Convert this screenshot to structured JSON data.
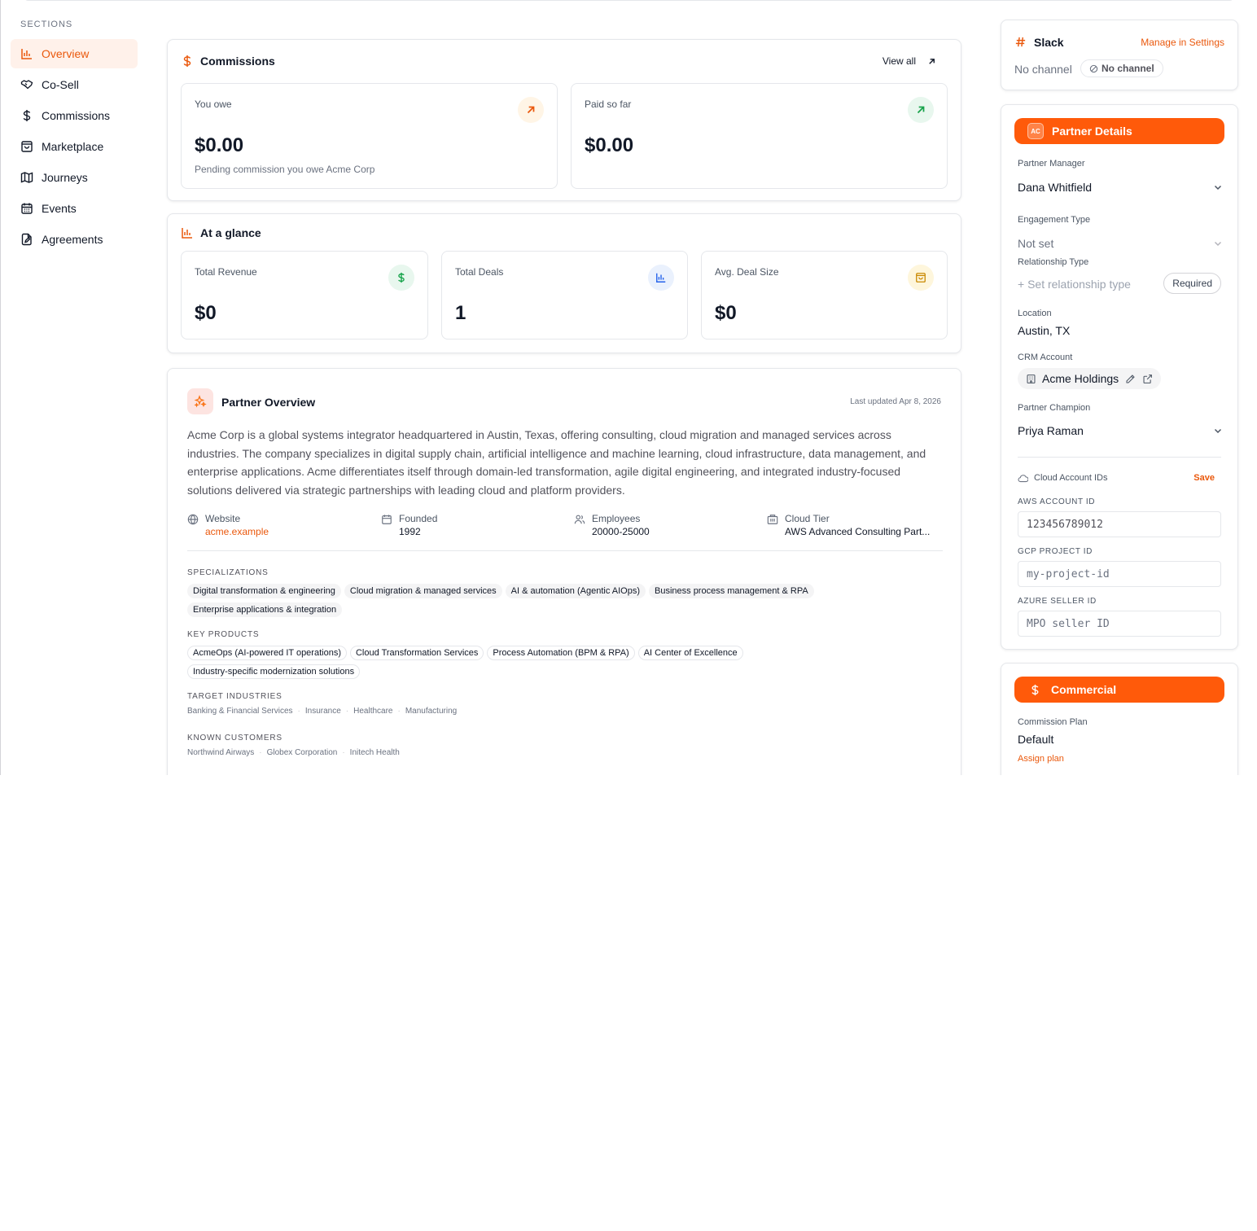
{
  "sidebar": {
    "title": "SECTIONS",
    "items": [
      {
        "label": "Overview",
        "icon": "bar-chart-icon",
        "active": true
      },
      {
        "label": "Co-Sell",
        "icon": "handshake-icon"
      },
      {
        "label": "Commissions",
        "icon": "dollar-icon"
      },
      {
        "label": "Marketplace",
        "icon": "shopping-bag-icon"
      },
      {
        "label": "Journeys",
        "icon": "map-icon"
      },
      {
        "label": "Events",
        "icon": "calendar-icon"
      },
      {
        "label": "Agreements",
        "icon": "file-edit-icon"
      }
    ]
  },
  "commissions": {
    "title": "Commissions",
    "view_all": "View all",
    "you_owe": {
      "label": "You owe",
      "value": "$0.00",
      "sub": "Pending commission you owe Acme Corp"
    },
    "paid": {
      "label": "Paid so far",
      "value": "$0.00"
    }
  },
  "glance": {
    "title": "At a glance",
    "revenue": {
      "label": "Total Revenue",
      "value": "$0"
    },
    "deals": {
      "label": "Total Deals",
      "value": "1"
    },
    "avg": {
      "label": "Avg. Deal Size",
      "value": "$0"
    }
  },
  "overview": {
    "title": "Partner Overview",
    "updated": "Last updated Apr 8, 2026",
    "description": "Acme Corp is a global systems integrator headquartered in Austin, Texas, offering consulting, cloud migration and managed services across industries. The company specializes in digital supply chain, artificial intelligence and machine learning, cloud infrastructure, data management, and enterprise applications. Acme differentiates itself through domain-led transformation, agile digital engineering, and integrated industry-focused solutions delivered via strategic partnerships with leading cloud and platform providers.",
    "website": {
      "label": "Website",
      "value": "acme.example"
    },
    "founded": {
      "label": "Founded",
      "value": "1992"
    },
    "employees": {
      "label": "Employees",
      "value": "20000-25000"
    },
    "tier": {
      "label": "Cloud Tier",
      "value": "AWS Advanced Consulting Part..."
    },
    "specializations_label": "SPECIALIZATIONS",
    "specializations": [
      "Digital transformation & engineering",
      "Cloud migration & managed services",
      "AI & automation (Agentic AIOps)",
      "Business process management & RPA",
      "Enterprise applications & integration"
    ],
    "products_label": "KEY PRODUCTS",
    "products": [
      "AcmeOps (AI-powered IT operations)",
      "Cloud Transformation Services",
      "Process Automation (BPM & RPA)",
      "AI Center of Excellence",
      "Industry-specific modernization solutions"
    ],
    "industries_label": "TARGET INDUSTRIES",
    "industries": [
      "Banking & Financial Services",
      "Insurance",
      "Healthcare",
      "Manufacturing"
    ],
    "customers_label": "KNOWN CUSTOMERS",
    "customers": [
      "Northwind Airways",
      "Globex Corporation",
      "Initech Health"
    ]
  },
  "slack": {
    "title": "Slack",
    "manage": "Manage in Settings",
    "no_channel_text": "No channel",
    "no_channel_badge": "No channel"
  },
  "partner": {
    "title": "Partner Details",
    "avatar": "AC",
    "manager": {
      "label": "Partner Manager",
      "value": "Dana Whitfield"
    },
    "engagement": {
      "label": "Engagement Type",
      "value": "Not set"
    },
    "relationship": {
      "label": "Relationship Type",
      "value": "+ Set relationship type",
      "badge": "Required"
    },
    "location": {
      "label": "Location",
      "value": "Austin, TX"
    },
    "crm": {
      "label": "CRM Account",
      "value": "Acme Holdings"
    },
    "champion": {
      "label": "Partner Champion",
      "value": "Priya Raman"
    },
    "cloud": {
      "label": "Cloud Account IDs",
      "save": "Save"
    },
    "aws": {
      "label": "AWS ACCOUNT ID",
      "value": "123456789012"
    },
    "gcp": {
      "label": "GCP PROJECT ID",
      "placeholder": "my-project-id"
    },
    "azure": {
      "label": "AZURE SELLER ID",
      "placeholder": "MPO seller ID"
    }
  },
  "commercial": {
    "title": "Commercial",
    "plan_label": "Commission Plan",
    "plan_value": "Default",
    "assign": "Assign plan"
  },
  "colors": {
    "accent": "#ff5a0a",
    "accent_text": "#ea580c"
  }
}
